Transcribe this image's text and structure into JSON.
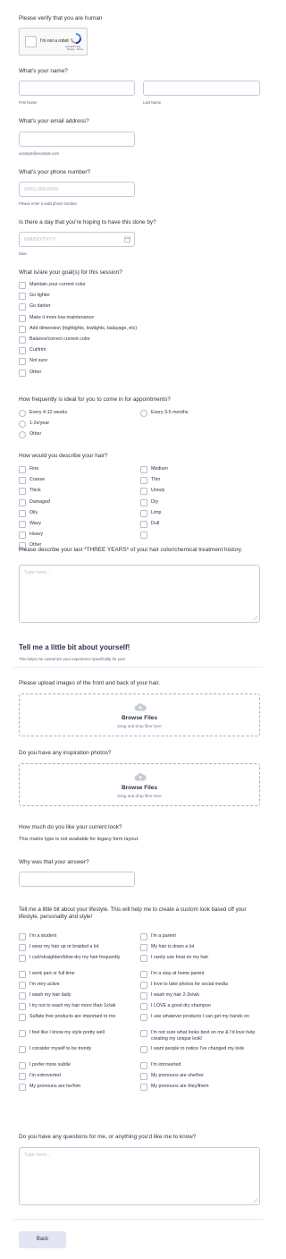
{
  "captcha": {
    "question": "Please verify that you are human",
    "label": "I'm not a robot",
    "brand": "reCAPTCHA",
    "links": "Privacy - Terms"
  },
  "name": {
    "question": "What's your name?",
    "first_sub": "First Name",
    "last_sub": "Last Name"
  },
  "email": {
    "question": "What's your email address?",
    "sub": "example@example.com"
  },
  "phone": {
    "question": "What's your phone number?",
    "placeholder": "(000) 000-0000",
    "sub": "Please enter a valid phone number."
  },
  "date": {
    "question": "Is there a day that you're hoping to have this done by?",
    "placeholder": "MM/DD/YYYY",
    "sub": "Date"
  },
  "goals": {
    "question": "What is/are your goal(s) for this session?",
    "options": [
      "Maintain your current color",
      "Go lighter",
      "Go darker",
      "Make it more low-maintenance",
      "Add dimension (highlights, lowlights, balayage, etc)",
      "Balance/correct current color",
      "Cut/trim",
      "Not sure",
      "Other"
    ]
  },
  "frequency": {
    "question": "How frequently is ideal for you to come in for appointments?",
    "options": [
      "Every 4-12 weeks",
      "Every 3-5 months",
      "1-2x/year",
      "Other"
    ]
  },
  "hair": {
    "question": "How would you describe your hair?",
    "left": [
      "Fine",
      "Coarse",
      "Thick",
      "Damaged",
      "Oily",
      "Wavy",
      "Heavy",
      "Other"
    ],
    "right": [
      "Medium",
      "Thin",
      "Unruly",
      "Dry",
      "Limp",
      "Dull",
      ""
    ]
  },
  "history": {
    "question": "Please describe your last *THREE YEARS* of your hair color/chemical treatment history.",
    "placeholder": "Type here..."
  },
  "about": {
    "heading": "Tell me a little bit about yourself!",
    "sub": "This helps me customize your experience specifically for you!"
  },
  "upload1": {
    "question": "Please upload images of the front and back of your hair.",
    "button": "Browse Files",
    "hint": "Drag and drop files here"
  },
  "upload2": {
    "question": "Do you have any inspiration photos?",
    "button": "Browse Files",
    "hint": "Drag and drop files here"
  },
  "matrix": {
    "question": "How much do you like your current look?",
    "note": "This matrix type is not available for legacy form layout."
  },
  "why": {
    "question": "Why was that your answer?"
  },
  "lifestyle": {
    "question": "Tell me a little bit about your lifestyle. This will help me to create a custom look based off your lifestyle, personality and style!",
    "left": [
      "I'm a student",
      "I wear my hair up or braided a lot",
      "I curl/straighten/blow-dry my hair frequently",
      "I work part or full time",
      "I'm very active",
      "I wash my hair daily",
      "I try not to wash my hair more than 1x/wk",
      "Sulfate free products are important to me",
      "I feel like I know my style pretty well",
      "I consider myself to be trendy",
      "I prefer more subtle",
      "I'm extroverted",
      "My pronouns are he/him"
    ],
    "right": [
      "I'm a parent",
      "My hair is down a lot",
      "I rarely use heat on my hair",
      "I'm a stay at home parent",
      "I love to take photos for social media",
      "I wash my hair 2-3x/wk",
      "I LOVE a good dry shampoo",
      "I use whatever products I can get my hands on",
      "I'm not sure what looks best on me & I'd love help creating my unique look!",
      "I want people to notice I've changed my look",
      "I'm introverted",
      "My pronouns are she/her",
      "My pronouns are they/them"
    ]
  },
  "questions": {
    "question": "Do you have any questions for me, or anything you'd like me to know?",
    "placeholder": "Type here..."
  },
  "footer": {
    "back": "Back"
  },
  "colors": {
    "text": "#2c3345",
    "border": "#c3cad8",
    "back_button": "#e3e5f5"
  }
}
